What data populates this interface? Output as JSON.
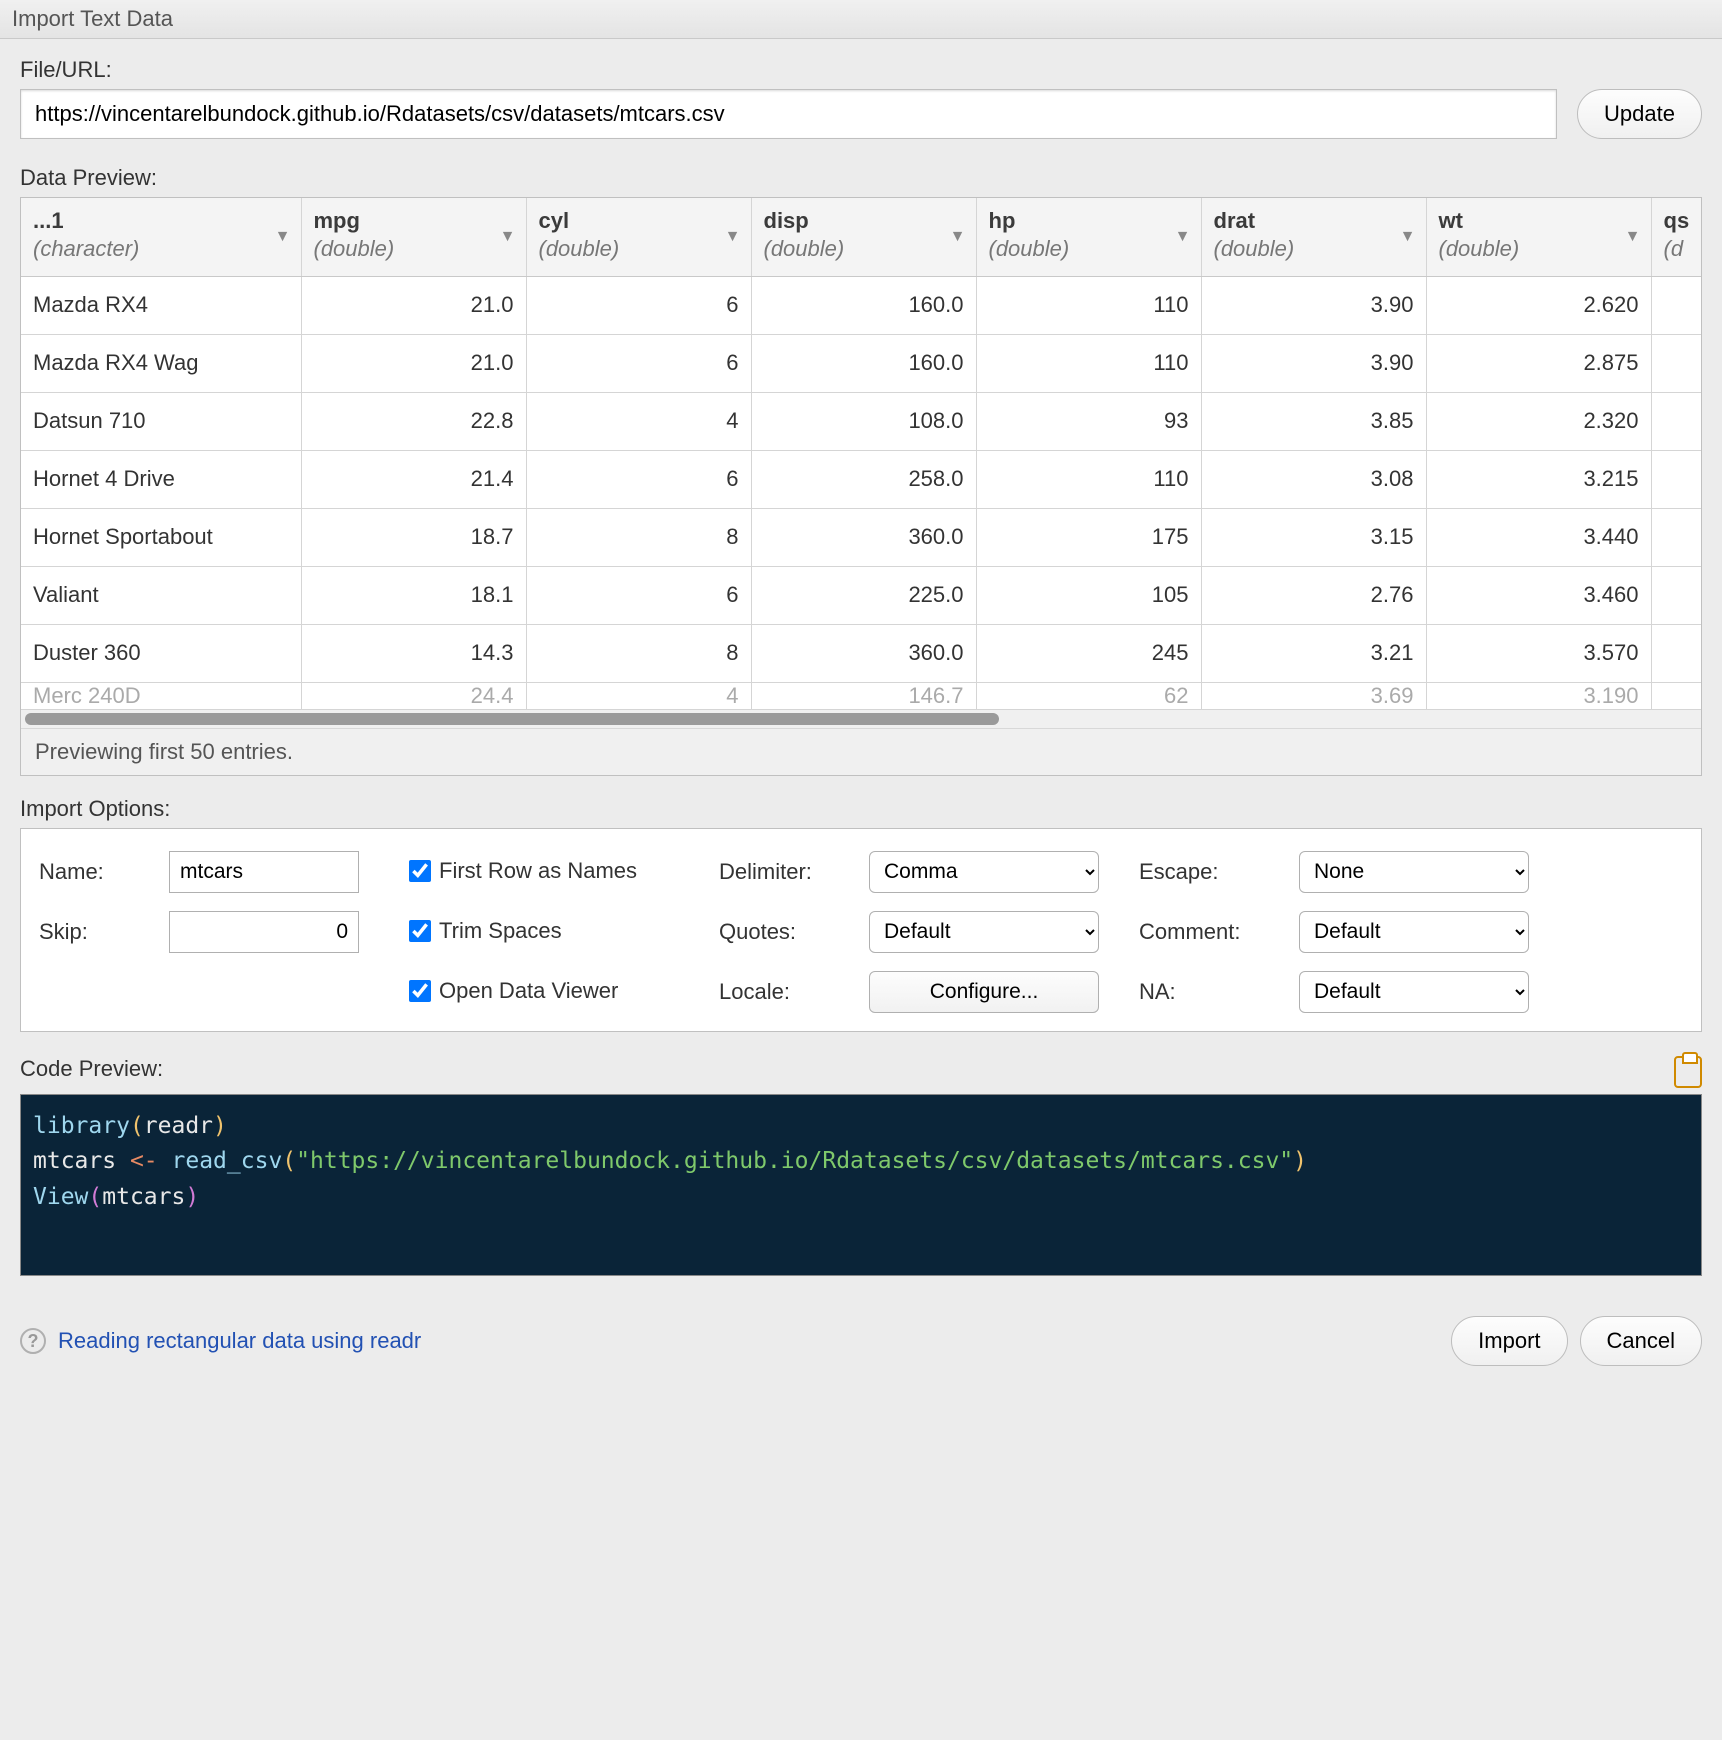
{
  "window": {
    "title": "Import Text Data"
  },
  "file": {
    "label": "File/URL:",
    "url": "https://vincentarelbundock.github.io/Rdatasets/csv/datasets/mtcars.csv",
    "update_btn": "Update"
  },
  "preview": {
    "label": "Data Preview:",
    "footer": "Previewing first 50 entries.",
    "columns": [
      {
        "name": "...1",
        "type": "(character)"
      },
      {
        "name": "mpg",
        "type": "(double)"
      },
      {
        "name": "cyl",
        "type": "(double)"
      },
      {
        "name": "disp",
        "type": "(double)"
      },
      {
        "name": "hp",
        "type": "(double)"
      },
      {
        "name": "drat",
        "type": "(double)"
      },
      {
        "name": "wt",
        "type": "(double)"
      },
      {
        "name": "qs",
        "type": "(d"
      }
    ],
    "rows": [
      [
        "Mazda RX4",
        "21.0",
        "6",
        "160.0",
        "110",
        "3.90",
        "2.620"
      ],
      [
        "Mazda RX4 Wag",
        "21.0",
        "6",
        "160.0",
        "110",
        "3.90",
        "2.875"
      ],
      [
        "Datsun 710",
        "22.8",
        "4",
        "108.0",
        "93",
        "3.85",
        "2.320"
      ],
      [
        "Hornet 4 Drive",
        "21.4",
        "6",
        "258.0",
        "110",
        "3.08",
        "3.215"
      ],
      [
        "Hornet Sportabout",
        "18.7",
        "8",
        "360.0",
        "175",
        "3.15",
        "3.440"
      ],
      [
        "Valiant",
        "18.1",
        "6",
        "225.0",
        "105",
        "2.76",
        "3.460"
      ],
      [
        "Duster 360",
        "14.3",
        "8",
        "360.0",
        "245",
        "3.21",
        "3.570"
      ]
    ],
    "partial_row": [
      "Merc 240D",
      "24.4",
      "4",
      "146.7",
      "62",
      "3.69",
      "3.190"
    ]
  },
  "options": {
    "label": "Import Options:",
    "name_label": "Name:",
    "name_value": "mtcars",
    "skip_label": "Skip:",
    "skip_value": "0",
    "first_row": "First Row as Names",
    "trim": "Trim Spaces",
    "open_viewer": "Open Data Viewer",
    "delimiter_label": "Delimiter:",
    "delimiter_value": "Comma",
    "quotes_label": "Quotes:",
    "quotes_value": "Default",
    "locale_label": "Locale:",
    "locale_btn": "Configure...",
    "escape_label": "Escape:",
    "escape_value": "None",
    "comment_label": "Comment:",
    "comment_value": "Default",
    "na_label": "NA:",
    "na_value": "Default"
  },
  "code": {
    "label": "Code Preview:",
    "l1_fn": "library",
    "l1_arg": "readr",
    "l2_id": "mtcars",
    "l2_op": "<-",
    "l2_fn": "read_csv",
    "l2_str": "\"https://vincentarelbundock.github.io/Rdatasets/csv/datasets/mtcars.csv\"",
    "l3_fn": "View",
    "l3_arg": "mtcars"
  },
  "footer": {
    "help_link": "Reading rectangular data using readr",
    "import_btn": "Import",
    "cancel_btn": "Cancel"
  }
}
